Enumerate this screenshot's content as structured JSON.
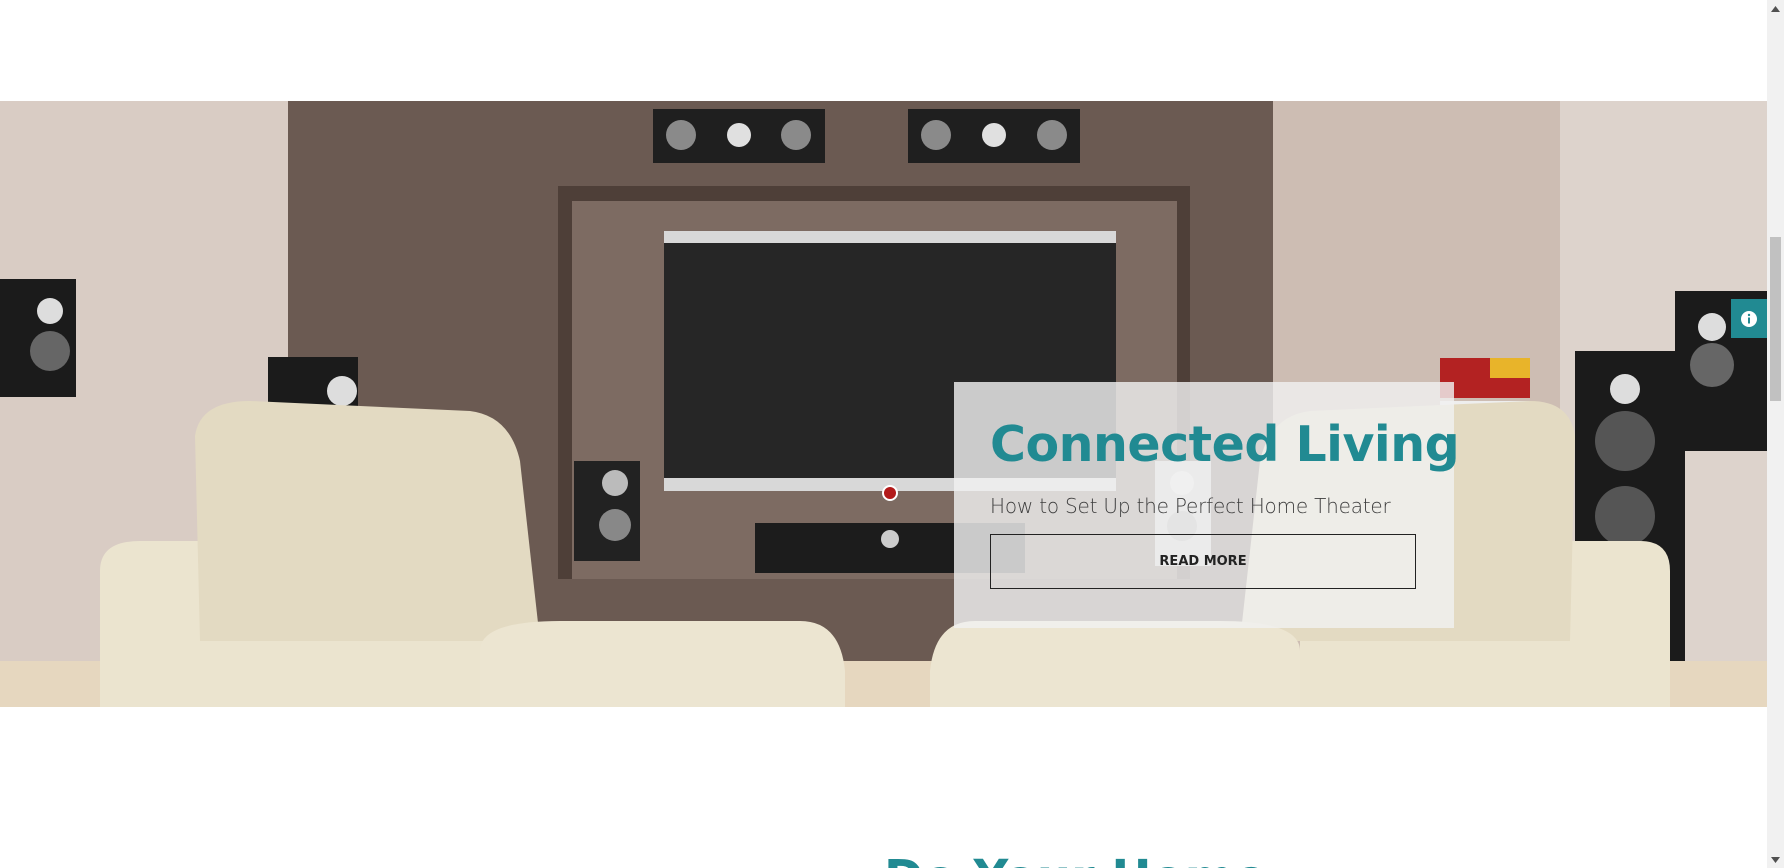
{
  "hero": {
    "image": "home-theater-room-icon",
    "card": {
      "title": "Connected Living",
      "subtitle": "How to Set Up the Perfect Home Theater",
      "button_label": "READ MORE"
    }
  },
  "info_tab": {
    "icon": "info-icon"
  },
  "next_section": {
    "heading": "Do Your Home"
  },
  "colors": {
    "accent": "#218a92",
    "card_bg": "#f0f0f0"
  }
}
